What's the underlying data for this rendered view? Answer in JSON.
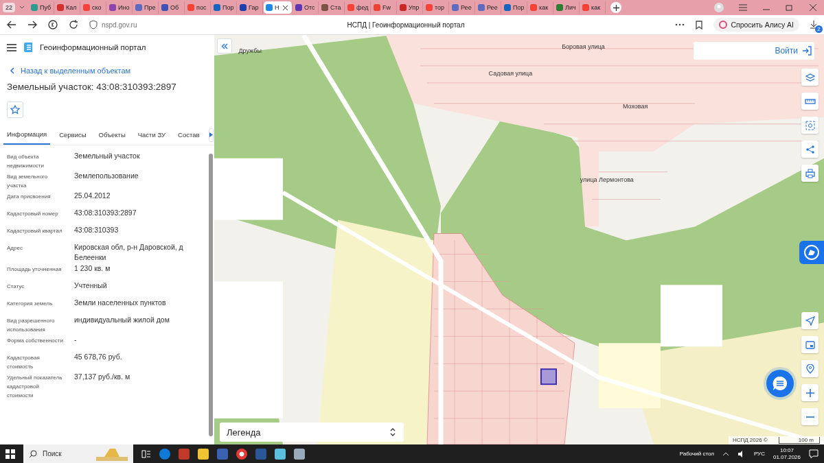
{
  "browser": {
    "tab_count": "22",
    "tabs": [
      {
        "label": "Пуб",
        "selected": false
      },
      {
        "label": "Кал",
        "selected": false
      },
      {
        "label": "ско",
        "selected": false
      },
      {
        "label": "Ино",
        "selected": false
      },
      {
        "label": "Пре",
        "selected": false
      },
      {
        "label": "Об",
        "selected": false
      },
      {
        "label": "пос",
        "selected": false
      },
      {
        "label": "Пор",
        "selected": false
      },
      {
        "label": "Гар",
        "selected": false
      },
      {
        "label": "Н",
        "selected": true
      },
      {
        "label": "Отс",
        "selected": false
      },
      {
        "label": "Ста",
        "selected": false
      },
      {
        "label": "фед",
        "selected": false
      },
      {
        "label": "Fw",
        "selected": false
      },
      {
        "label": "Упр",
        "selected": false
      },
      {
        "label": "тор",
        "selected": false
      },
      {
        "label": "Рее",
        "selected": false
      },
      {
        "label": "Рее",
        "selected": false
      },
      {
        "label": "Пор",
        "selected": false
      },
      {
        "label": "как",
        "selected": false
      },
      {
        "label": "Лич",
        "selected": false
      },
      {
        "label": "как",
        "selected": false
      }
    ],
    "url": "nspd.gov.ru",
    "page_title": "НСПД | Геоинформационный портал",
    "alice": "Спросить Алису AI",
    "downloads_badge": "2"
  },
  "app": {
    "title": "Геоинформационный портал",
    "back_link": "Назад к выделенным объектам",
    "object_title": "Земельный участок: 43:08:310393:2897",
    "tabs": [
      {
        "label": "Информация",
        "selected": true
      },
      {
        "label": "Сервисы",
        "selected": false
      },
      {
        "label": "Объекты",
        "selected": false
      },
      {
        "label": "Части ЗУ",
        "selected": false
      },
      {
        "label": "Состав",
        "selected": false
      }
    ],
    "properties": [
      {
        "label": "Вид объекта недвижимости",
        "value": "Земельный участок"
      },
      {
        "label": "Вид земельного участка",
        "value": "Землепользование"
      },
      {
        "label": "Дата присвоения",
        "value": "25.04.2012"
      },
      {
        "label": "Кадастровый номер",
        "value": "43:08:310393:2897"
      },
      {
        "label": "Кадастровый квартал",
        "value": "43:08:310393"
      },
      {
        "label": "Адрес",
        "value": "Кировская обл, р-н Даровской, д Белеенки"
      },
      {
        "label": "Площадь уточненная",
        "value": "1 230 кв. м"
      },
      {
        "label": "Статус",
        "value": "Учтенный"
      },
      {
        "label": "Категория земель",
        "value": "Земли населенных пунктов"
      },
      {
        "label": "Вид разрешенного использования",
        "value": "индивидуальный жилой дом"
      },
      {
        "label": "Форма собственности",
        "value": "-"
      },
      {
        "label": "Кадастровая стоимость",
        "value": "45 678,76 руб."
      },
      {
        "label": "Удельный показатель кадастровой стоимости",
        "value": "37,137 руб./кв. м"
      }
    ]
  },
  "map": {
    "login": "Войти",
    "legend": "Легенда",
    "attribution": "НСПД 2026 ©",
    "scale": "100 m",
    "labels": [
      "Дружбы",
      "Боровая улица",
      "Садовая улица",
      "Моховая",
      "улица Лермонтова"
    ]
  },
  "taskbar": {
    "search": "Поиск",
    "desktop": "Рабочий стол",
    "lang": "РУС",
    "time": "10:07",
    "date": "01.07.2026"
  }
}
